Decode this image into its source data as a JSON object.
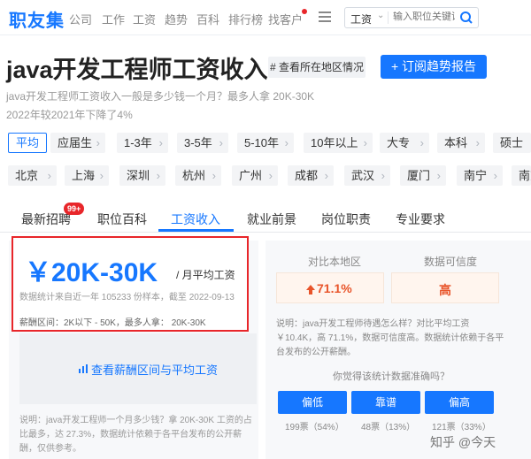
{
  "nav": {
    "logo": "职友集",
    "links": [
      "公司",
      "工作",
      "工资",
      "趋势",
      "百科",
      "排行榜",
      "找客户"
    ],
    "search_category": "工资",
    "search_placeholder": "输入职位关键词"
  },
  "header": {
    "title": "java开发工程师工资收入",
    "region_button": "# 查看所在地区情况",
    "subscribe_button": "+ 订阅趋势报告",
    "desc_line1": "java开发工程师工资收入一般是多少钱一个月？最多人拿 20K-30K",
    "desc_line2": "2022年较2021年下降了4%"
  },
  "filters": {
    "row1": [
      "平均",
      "应届生",
      "1-3年",
      "3-5年",
      "5-10年",
      "10年以上",
      "大专",
      "本科",
      "硕士"
    ],
    "row2": [
      "北京",
      "上海",
      "深圳",
      "杭州",
      "广州",
      "成都",
      "武汉",
      "厦门",
      "南宁",
      "南京"
    ]
  },
  "tabs": {
    "items": [
      "最新招聘",
      "职位百科",
      "工资收入",
      "就业前景",
      "岗位职责",
      "专业要求"
    ],
    "badge": "99+",
    "active": "工资收入"
  },
  "salary": {
    "value": "￥20K-30K",
    "unit": "/ 月平均工资",
    "stat_note": "数据统计来自近一年 105233 份样本，截至 2022-09-13",
    "range_note": "薪酬区间：2K以下 - 50K，最多人拿： 20K-30K",
    "chart_button": "查看薪酬区间与平均工资",
    "explain_line1": "说明：java开发工程师一个月多少钱？拿 20K-30K 工资的占",
    "explain_line2": "比最多，达 27.3%，数据统计依赖于各平台发布的公开薪",
    "explain_line3": "酬，仅供参考。"
  },
  "compare": {
    "local_label": "对比本地区",
    "local_value": "71.1%",
    "credibility_label": "数据可信度",
    "credibility_value": "高",
    "explain_line1": "说明：java开发工程师待遇怎么样？对比平均工资",
    "explain_line2": "￥10.4K，高 71.1%，数据可信度高。数据统计依赖于各平",
    "explain_line3": "台发布的公开薪酬。",
    "question": "你觉得该统计数据准确吗？"
  },
  "votes": [
    {
      "label": "偏低",
      "count": "199票（54%）"
    },
    {
      "label": "靠谱",
      "count": "48票（13%）"
    },
    {
      "label": "偏高",
      "count": "121票（33%）"
    }
  ],
  "watermark": "知乎 @今天",
  "colors": {
    "accent": "#1677ff",
    "highlight": "#e8262a",
    "increase": "#e8542a"
  }
}
